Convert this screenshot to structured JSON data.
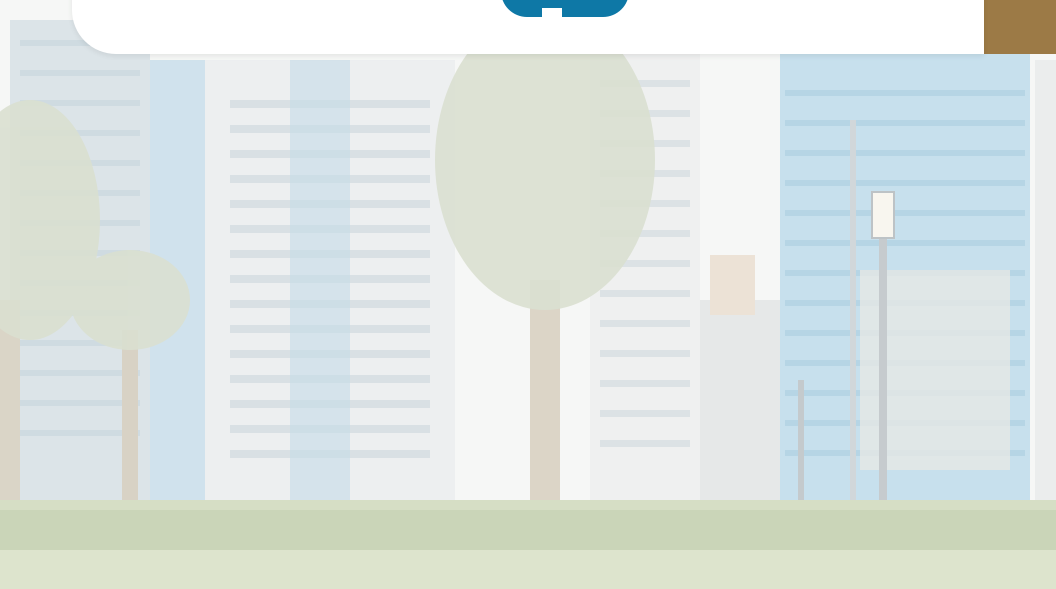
{
  "colors": {
    "card_background": "#ffffff",
    "tab_button": "#0e78a6",
    "gold_accent": "#9c7a46",
    "sky": "#f3f4f2",
    "glass_blue": "#a9cfe0",
    "building_white": "#e7e9ea",
    "greenery": "#b9c7a0"
  },
  "icons": {
    "tab_icon": "info-icon"
  }
}
